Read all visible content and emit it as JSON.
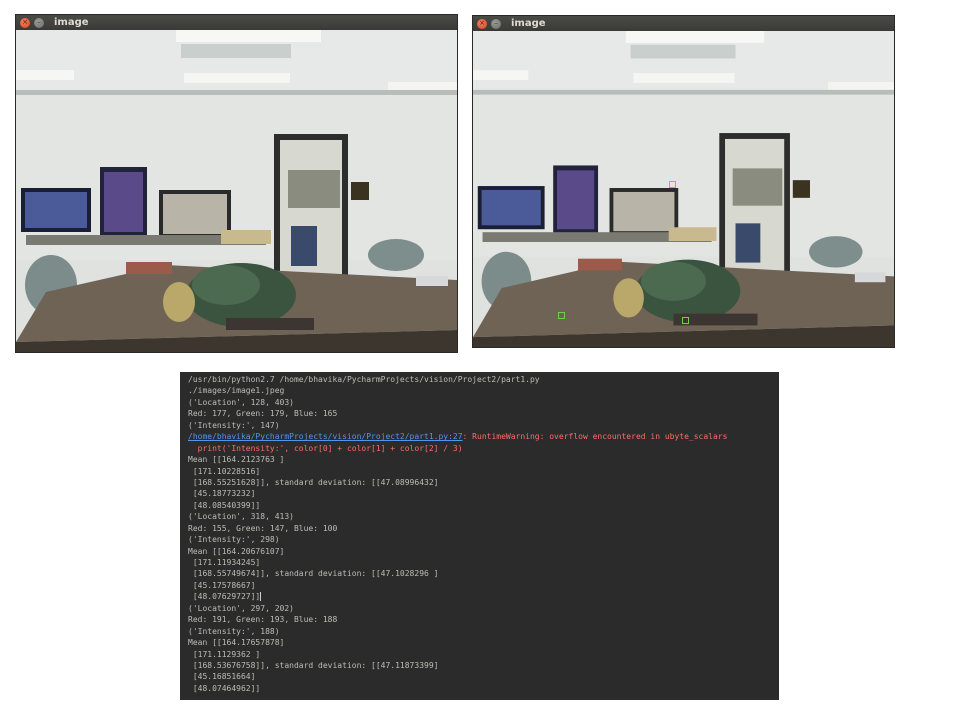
{
  "left_window": {
    "title": "image",
    "close_icon": "×",
    "minimize_icon": "–",
    "icons": [
      "close-icon",
      "minimize-icon"
    ]
  },
  "right_window": {
    "title": "image",
    "close_icon": "×",
    "minimize_icon": "–",
    "icons": [
      "close-icon",
      "minimize-icon"
    ],
    "marker_color": "#6fd14a"
  },
  "terminal": {
    "background": "#2b2b2b",
    "text_color": "#bdbdb6",
    "error_color": "#ff6b68",
    "link_color": "#5394ec",
    "lines": [
      "/usr/bin/python2.7 /home/bhavika/PycharmProjects/vision/Project2/part1.py",
      "./images/image1.jpeg",
      "('Location', 128, 403)",
      "Red: 177, Green: 179, Blue: 165",
      "('Intensity:', 147)"
    ],
    "warning_link": "/home/bhavika/PycharmProjects/vision/Project2/part1.py:27",
    "warning_text": ": RuntimeWarning: overflow encountered in ubyte_scalars",
    "warning_code": "  print('Intensity:', color[0] + color[1] + color[2] / 3)",
    "lines_after": [
      "Mean [[164.2123763 ]",
      " [171.10228516]",
      " [168.55251628]], standard deviation: [[47.08996432]",
      " [45.18773232]",
      " [48.08540399]]",
      "('Location', 318, 413)",
      "Red: 155, Green: 147, Blue: 100",
      "('Intensity:', 298)",
      "Mean [[164.20676107]",
      " [171.11934245]",
      " [168.55749674]], standard deviation: [[47.1028296 ]",
      " [45.17578667]"
    ],
    "cursor_line": " [48.07629727]]",
    "lines_end": [
      "('Location', 297, 202)",
      "Red: 191, Green: 193, Blue: 188",
      "('Intensity:', 188)",
      "Mean [[164.17657878]",
      " [171.1129362 ]",
      " [168.53676758]], standard deviation: [[47.11873399]",
      " [45.16851664]",
      " [48.07464962]]"
    ]
  }
}
